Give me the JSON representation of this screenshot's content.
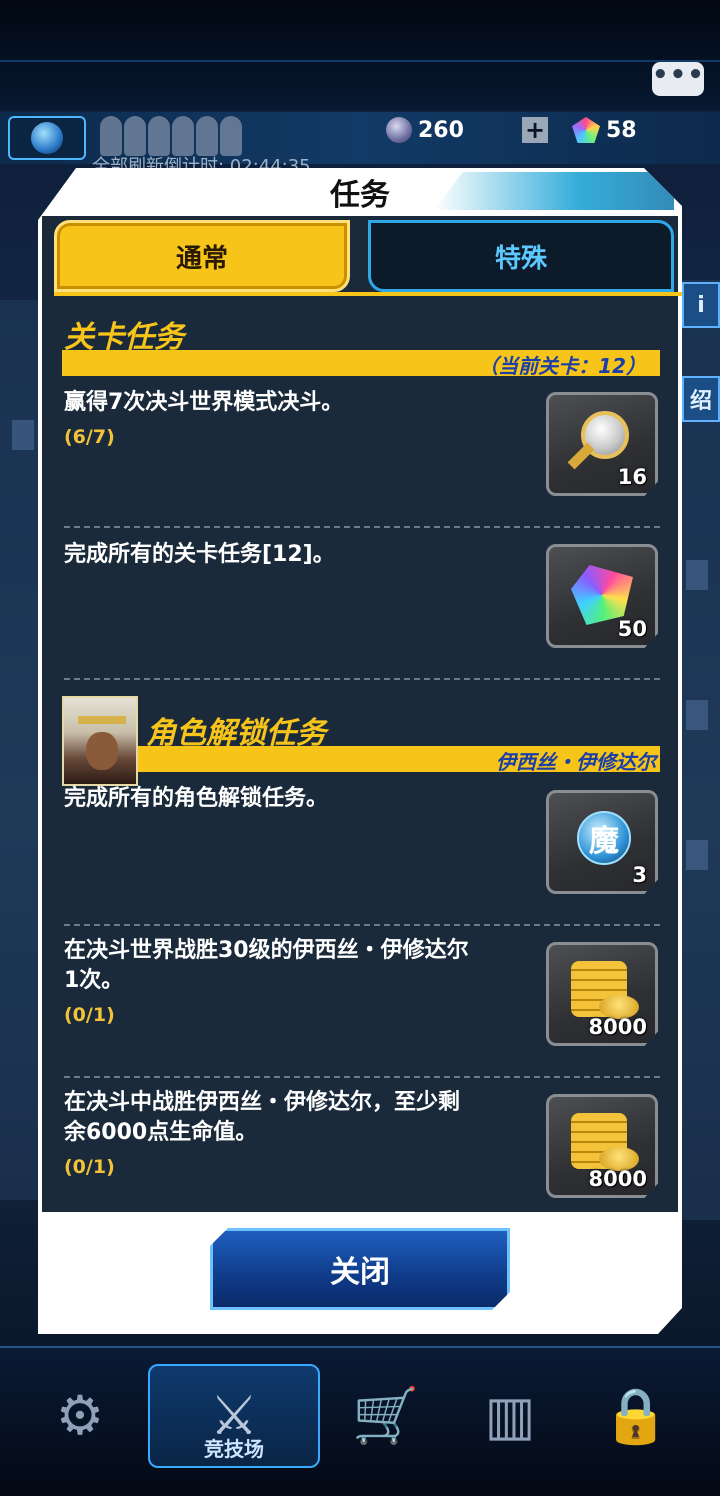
{
  "hud": {
    "refresh_text": "全部刷新倒计时: 02:44:35",
    "currency_a": "260",
    "currency_b": "58",
    "side_tab_right_1": "i",
    "side_tab_right_2": "绍"
  },
  "modal": {
    "title": "任务",
    "tabs": [
      {
        "label": "通常",
        "active": true
      },
      {
        "label": "特殊",
        "active": false
      }
    ],
    "stage_section": {
      "title": "关卡任务",
      "subtitle": "（当前关卡：12）",
      "quests": [
        {
          "text": "赢得7次决斗世界模式决斗。",
          "progress": "(6/7)",
          "reward_icon": "key-icon",
          "reward_count": "16"
        },
        {
          "text": "完成所有的关卡任务[12]。",
          "progress": "",
          "reward_icon": "crystal-icon",
          "reward_count": "50"
        }
      ]
    },
    "character_section": {
      "title": "角色解锁任务",
      "subtitle": "伊西丝・伊修达尔",
      "quests": [
        {
          "text": "完成所有的角色解锁任务。",
          "progress": "",
          "reward_icon": "orb-icon",
          "reward_glyph": "魔",
          "reward_count": "3"
        },
        {
          "text_line1": "在决斗世界战胜30级的伊西丝・伊修达尔",
          "text_line2": "1次。",
          "progress": "(0/1)",
          "reward_icon": "coins-icon",
          "reward_count": "8000"
        },
        {
          "text_line1": "在决斗中战胜伊西丝・伊修达尔，至少剩",
          "text_line2": "余6000点生命值。",
          "progress": "(0/1)",
          "reward_icon": "coins-icon",
          "reward_count": "8000"
        }
      ]
    },
    "close_label": "关闭"
  },
  "bottom_nav": {
    "active_label": "竞技场"
  },
  "colors": {
    "accent_yellow": "#f7c41a",
    "panel_bg": "#1a2a3b",
    "tab_special_text": "#5cc9ff",
    "subtitle_blue": "#1a3fa6"
  }
}
